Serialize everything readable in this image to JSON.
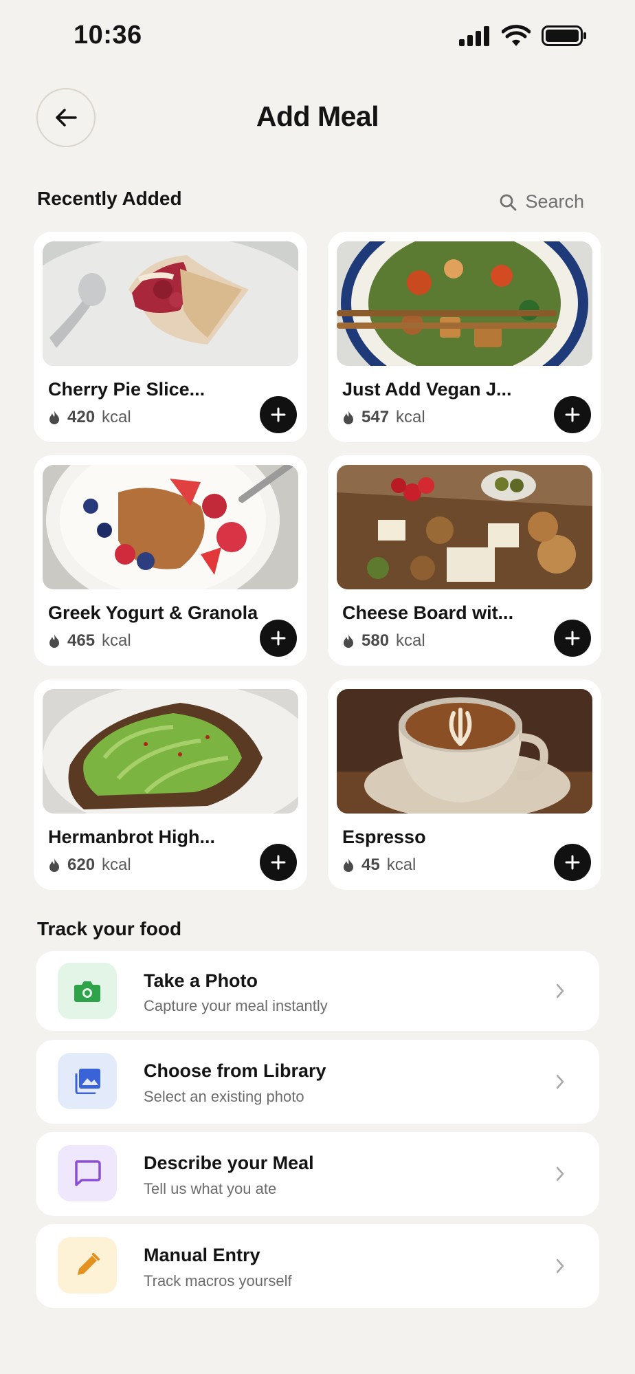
{
  "status_bar": {
    "time": "10:36"
  },
  "header": {
    "title": "Add Meal"
  },
  "recent": {
    "title": "Recently Added",
    "search_label": "Search",
    "items": [
      {
        "name": "Cherry Pie Slice...",
        "kcal_value": "420",
        "kcal_unit": "kcal"
      },
      {
        "name": "Just Add Vegan J...",
        "kcal_value": "547",
        "kcal_unit": "kcal"
      },
      {
        "name": "Greek Yogurt & Granola",
        "kcal_value": "465",
        "kcal_unit": "kcal"
      },
      {
        "name": "Cheese Board wit...",
        "kcal_value": "580",
        "kcal_unit": "kcal"
      },
      {
        "name": "Hermanbrot High...",
        "kcal_value": "620",
        "kcal_unit": "kcal"
      },
      {
        "name": "Espresso",
        "kcal_value": "45",
        "kcal_unit": "kcal"
      }
    ]
  },
  "track": {
    "title": "Track your food",
    "items": [
      {
        "label": "Take a Photo",
        "description": "Capture your meal instantly",
        "icon": "camera-icon",
        "color": "#2fa34a",
        "bg": "#e2f5e6"
      },
      {
        "label": "Choose from Library",
        "description": "Select an existing photo",
        "icon": "gallery-icon",
        "color": "#3a63d8",
        "bg": "#e3ebfb"
      },
      {
        "label": "Describe your Meal",
        "description": "Tell us what you ate",
        "icon": "chat-icon",
        "color": "#8b4fd6",
        "bg": "#efe7fb"
      },
      {
        "label": "Manual Entry",
        "description": "Track macros yourself",
        "icon": "pencil-icon",
        "color": "#e39220",
        "bg": "#fdf1d6"
      }
    ]
  }
}
